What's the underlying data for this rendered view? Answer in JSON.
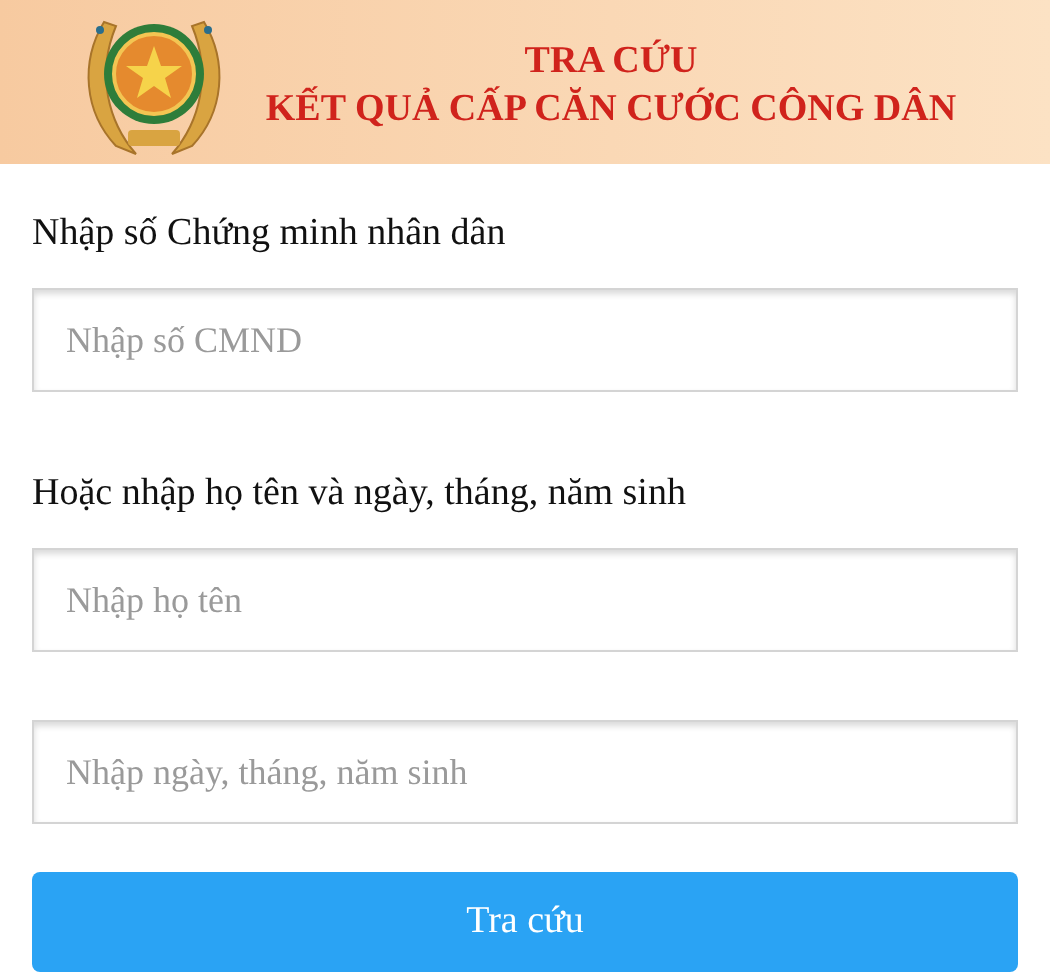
{
  "header": {
    "title_lines": [
      "TRA CỨU",
      "KẾT QUẢ CẤP CĂN CƯỚC CÔNG DÂN"
    ]
  },
  "form": {
    "items": [
      {
        "kind": "label",
        "text": "Nhập số Chứng minh nhân dân"
      },
      {
        "kind": "field",
        "placeholder": "Nhập số CMND"
      },
      {
        "kind": "label",
        "text": "Hoặc nhập họ tên và ngày, tháng, năm sinh"
      },
      {
        "kind": "field",
        "placeholder": "Nhập họ tên"
      },
      {
        "kind": "field",
        "placeholder": "Nhập ngày, tháng, năm sinh"
      },
      {
        "kind": "button",
        "text": "Tra cứu"
      }
    ]
  }
}
